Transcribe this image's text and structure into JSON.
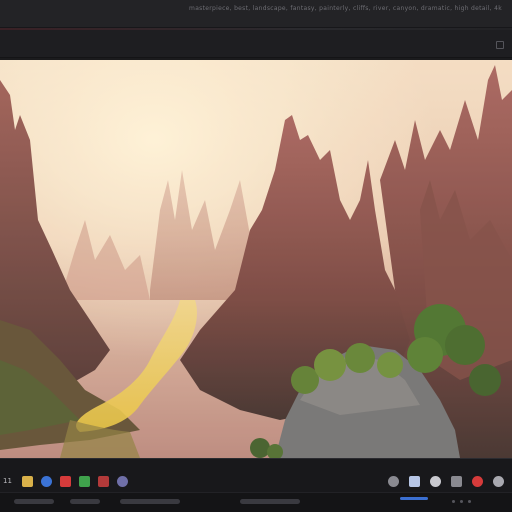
{
  "window": {
    "title_text": "masterpiece, best, landscape, fantasy, painterly, cliffs, river, canyon, dramatic, high detail, 4k"
  },
  "taskbar": {
    "left_label": "11",
    "left_icons": [
      {
        "name": "folder-icon",
        "color": "#d9b14a"
      },
      {
        "name": "app-blue-icon",
        "color": "#3b73d6"
      },
      {
        "name": "app-red-icon",
        "color": "#d63b3b"
      },
      {
        "name": "app-green-icon",
        "color": "#3fa24c"
      },
      {
        "name": "app-dark-icon",
        "color": "#b33a3a"
      },
      {
        "name": "app-circle-icon",
        "color": "#6f6fa8"
      }
    ],
    "right_icons": [
      {
        "name": "network-icon",
        "color": "#8a8a91"
      },
      {
        "name": "chat-icon",
        "color": "#b7c6e6"
      },
      {
        "name": "cloud-icon",
        "color": "#c9c9cf"
      },
      {
        "name": "shield-icon",
        "color": "#8a8a91"
      },
      {
        "name": "record-icon",
        "color": "#d63b3b"
      },
      {
        "name": "user-avatar-icon",
        "color": "#a9a9b0"
      }
    ]
  },
  "colors": {
    "background": "#1b1b1d",
    "accent": "#3b6fd1"
  },
  "image": {
    "subject": "fantasy canyon landscape with tall red rock spires and a glowing golden river"
  }
}
